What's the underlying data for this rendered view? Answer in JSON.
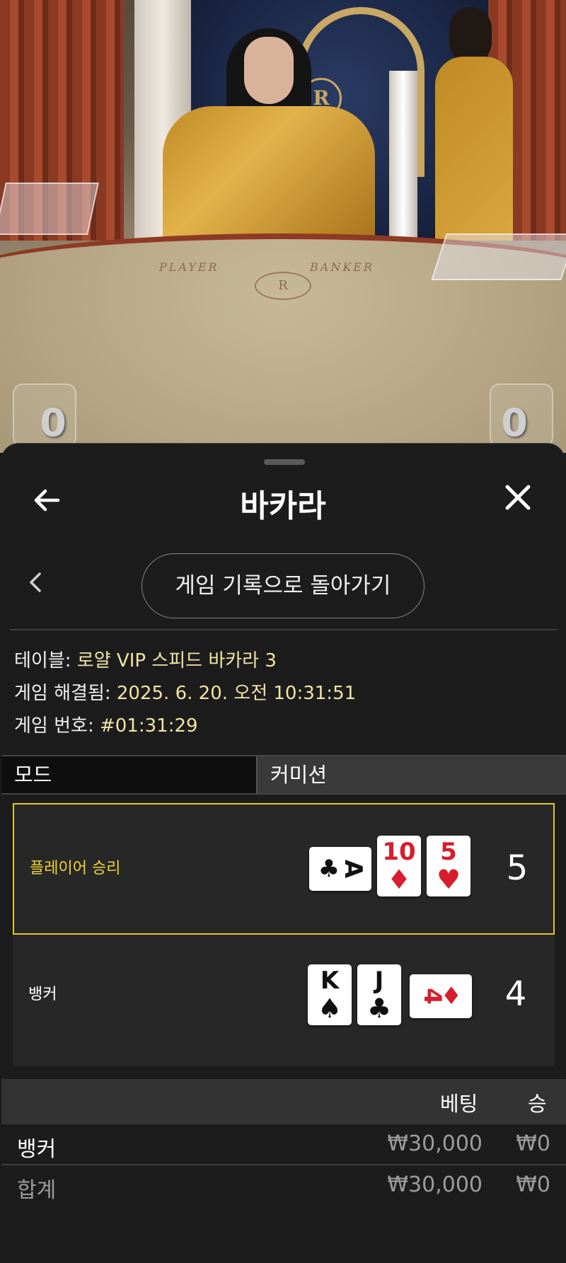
{
  "video": {
    "felt_player": "PLAYER",
    "felt_banker": "BANKER",
    "emblem_letter": "R",
    "player_score": "0",
    "banker_score": "0"
  },
  "header": {
    "title": "바카라",
    "back_icon": "arrow-left-icon",
    "close_icon": "close-icon"
  },
  "nav": {
    "prev_icon": "chevron-left-icon",
    "back_to_history_label": "게임 기록으로 돌아가기"
  },
  "info": {
    "table_label": "테이블:",
    "table_value": "로얄 VIP 스피드 바카라 3",
    "resolved_label": "게임 해결됨:",
    "resolved_value": "2025. 6. 20. 오전 10:31:51",
    "number_label": "게임 번호:",
    "number_value": "#01:31:29"
  },
  "tabs": {
    "mode_label": "모드",
    "commission_label": "커미션"
  },
  "results": {
    "player": {
      "label": "플레이어 승리",
      "cards": [
        {
          "rank": "A",
          "suit": "♣",
          "color": "black",
          "orientation": "horizontal"
        },
        {
          "rank": "10",
          "suit": "♦",
          "color": "red",
          "orientation": "vertical"
        },
        {
          "rank": "5",
          "suit": "♥",
          "color": "red",
          "orientation": "vertical"
        }
      ],
      "total": "5"
    },
    "banker": {
      "label": "뱅커",
      "cards": [
        {
          "rank": "K",
          "suit": "♠",
          "color": "black",
          "orientation": "vertical"
        },
        {
          "rank": "J",
          "suit": "♣",
          "color": "black",
          "orientation": "vertical"
        },
        {
          "rank": "4",
          "suit": "♦",
          "color": "red",
          "orientation": "horizontal"
        }
      ],
      "total": "4"
    }
  },
  "bets": {
    "col_bet": "베팅",
    "col_win": "승",
    "rows": [
      {
        "name": "뱅커",
        "bet": "₩30,000",
        "win": "₩0"
      }
    ],
    "total": {
      "name": "합계",
      "bet": "₩30,000",
      "win": "₩0"
    }
  },
  "colors": {
    "win_accent": "#e4c52c",
    "info_value": "#f1e3a6",
    "card_red": "#d81d2d"
  }
}
